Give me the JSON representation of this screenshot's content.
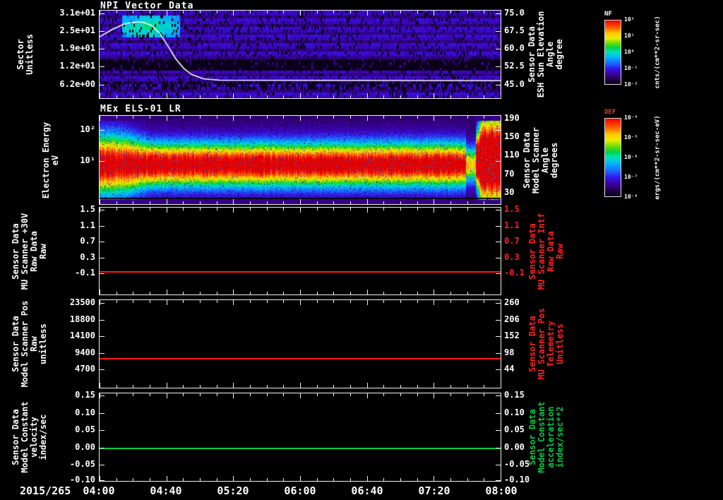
{
  "x_axis": {
    "date_label": "2015/265",
    "ticks": [
      "04:00",
      "04:40",
      "05:20",
      "06:00",
      "06:40",
      "07:20",
      "08:00"
    ]
  },
  "chart_data": [
    {
      "id": "npi",
      "type": "heatmap",
      "title": "NPI Vector Data",
      "y_axis": {
        "label_lines": [
          "Sector",
          "Unitless"
        ],
        "ticks": [
          "3.1e+01",
          "2.5e+01",
          "1.9e+01",
          "1.2e+01",
          "6.2e+00"
        ],
        "tick_fracs": [
          0.03,
          0.233,
          0.436,
          0.64,
          0.843
        ]
      },
      "right_axis": {
        "color": "#ffffff",
        "label_lines": [
          "Sensor Data",
          "ESH Sun Elevation",
          "Angle",
          "degree"
        ],
        "ticks": [
          "75.0",
          "67.5",
          "60.0",
          "52.5",
          "45.0"
        ],
        "tick_fracs": [
          0.03,
          0.233,
          0.436,
          0.64,
          0.843
        ]
      },
      "colorbar": {
        "name": "NF",
        "name_color": "#ffffff",
        "unit": "cnts/(cm**2-sr-sec)",
        "ticks": [
          "10²",
          "10¹",
          "10⁰",
          "10⁻¹",
          "10⁻²"
        ]
      },
      "overlay_line": {
        "name": "ESH Sun Elevation Angle",
        "color": "#ffffff",
        "points_frac": [
          [
            0,
            0.3
          ],
          [
            0.03,
            0.22
          ],
          [
            0.06,
            0.155
          ],
          [
            0.09,
            0.13
          ],
          [
            0.11,
            0.135
          ],
          [
            0.13,
            0.17
          ],
          [
            0.15,
            0.26
          ],
          [
            0.17,
            0.4
          ],
          [
            0.19,
            0.55
          ],
          [
            0.21,
            0.66
          ],
          [
            0.23,
            0.73
          ],
          [
            0.26,
            0.78
          ],
          [
            0.3,
            0.795
          ],
          [
            1,
            0.8
          ]
        ]
      }
    },
    {
      "id": "els",
      "type": "heatmap",
      "title": "MEx ELS-01 LR",
      "y_axis": {
        "label_lines": [
          "Electron Energy",
          "eV"
        ],
        "scale": "log",
        "ticks": [
          "10²",
          "10¹"
        ],
        "tick_fracs": [
          0.16,
          0.51
        ]
      },
      "right_axis": {
        "color": "#ffffff",
        "label_lines": [
          "Sensor Data",
          "Model Scanner",
          "Angle",
          "degrees"
        ],
        "ticks": [
          "190",
          "150",
          "110",
          "70",
          "30"
        ],
        "tick_fracs": [
          0.03,
          0.24,
          0.45,
          0.66,
          0.87
        ]
      },
      "colorbar": {
        "name": "DEF",
        "name_color": "#ff3020",
        "unit": "ergs/(cm**2-sr-sec-eV)",
        "ticks": [
          "10⁻⁴",
          "10⁻⁵",
          "10⁻⁶",
          "10⁻⁷",
          "10⁻⁸"
        ]
      }
    },
    {
      "id": "mu30v",
      "type": "line",
      "y_axis": {
        "label_lines": [
          "Sensor Data",
          "MU Scanner +30V",
          "Raw Data",
          "Raw"
        ],
        "ticks": [
          "1.5",
          "1.1",
          "0.7",
          "0.3",
          "-0.1"
        ],
        "tick_fracs": [
          0.024,
          0.208,
          0.392,
          0.576,
          0.76
        ]
      },
      "right_axis": {
        "color": "#ff2020",
        "label_lines": [
          "Sensor Data",
          "MU Scanner Intf",
          "Raw Data",
          "Raw"
        ],
        "ticks": [
          "1.5",
          "1.1",
          "0.7",
          "0.3",
          "-0.1"
        ],
        "tick_fracs": [
          0.024,
          0.208,
          0.392,
          0.576,
          0.76
        ]
      },
      "series": [
        {
          "name": "MU Scanner +30V Raw",
          "color": "#ff1515",
          "constant_value": 0.0,
          "y_frac": 0.73
        }
      ]
    },
    {
      "id": "scannerpos",
      "type": "line",
      "y_axis": {
        "label_lines": [
          "Sensor Data",
          "Model Scanner Pos",
          "Raw",
          "unitless"
        ],
        "ticks": [
          "23500",
          "18800",
          "14100",
          "9400",
          "4700"
        ],
        "tick_fracs": [
          0.032,
          0.222,
          0.413,
          0.603,
          0.794
        ]
      },
      "right_axis": {
        "color": "#ffffff",
        "label_color": "#ff2020",
        "label_lines": [
          "Sensor Data",
          "MU Scanner Pos",
          "Telemetry",
          "Unitless"
        ],
        "ticks": [
          "260",
          "206",
          "152",
          "98",
          "44"
        ],
        "tick_fracs": [
          0.032,
          0.222,
          0.413,
          0.603,
          0.794
        ]
      },
      "series": [
        {
          "name": "Model Scanner Pos Raw",
          "color": "#ff1515",
          "constant_value": 8000,
          "y_frac": 0.66
        }
      ]
    },
    {
      "id": "velocity",
      "type": "line",
      "y_axis": {
        "label_lines": [
          "Sensor Data",
          "Model Constant",
          "velocity",
          "index/sec"
        ],
        "ticks": [
          "0.15",
          "0.10",
          "0.05",
          "0.00",
          "-0.05",
          "-0.10"
        ],
        "tick_fracs": [
          0.024,
          0.222,
          0.42,
          0.619,
          0.817,
          0.99
        ]
      },
      "right_axis": {
        "color": "#ffffff",
        "label_color": "#00cc44",
        "label_lines": [
          "Sensor Data",
          "Model Constant",
          "acceleration",
          "index/sec**2"
        ],
        "ticks": [
          "0.15",
          "0.10",
          "0.05",
          "0.00",
          "-0.05",
          "-0.10"
        ],
        "tick_fracs": [
          0.024,
          0.222,
          0.42,
          0.619,
          0.817,
          0.99
        ]
      },
      "series": [
        {
          "name": "Model Constant velocity",
          "color": "#00cc44",
          "constant_value": 0.0,
          "y_frac": 0.62
        }
      ]
    }
  ]
}
